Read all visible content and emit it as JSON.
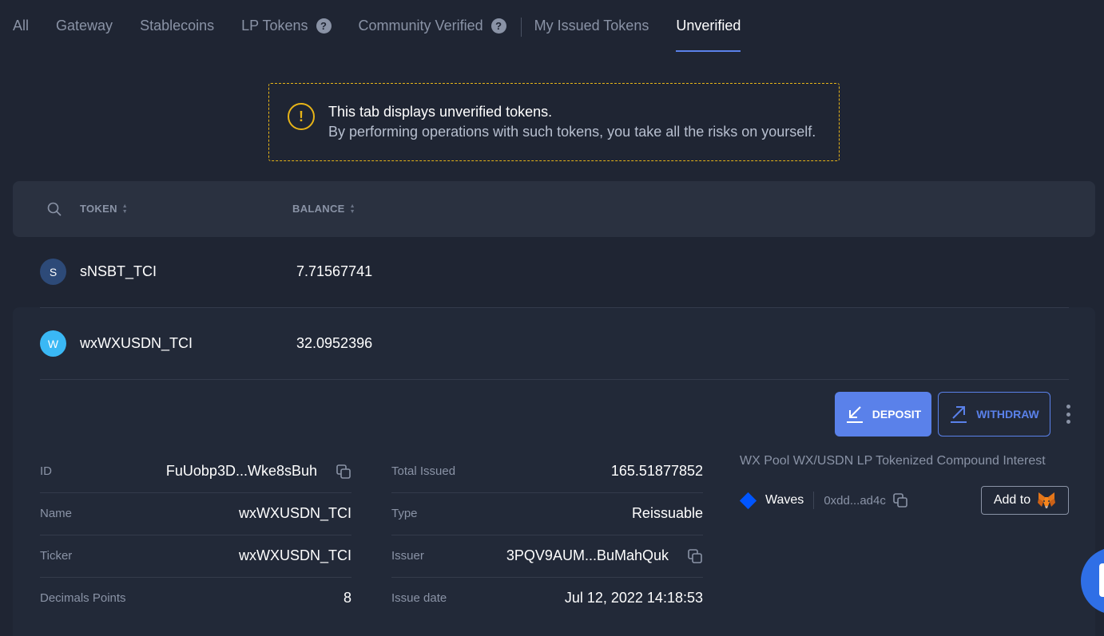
{
  "tabs": [
    {
      "label": "All",
      "active": false
    },
    {
      "label": "Gateway",
      "active": false
    },
    {
      "label": "Stablecoins",
      "active": false
    },
    {
      "label": "LP Tokens",
      "active": false,
      "help": "?"
    },
    {
      "label": "Community Verified",
      "active": false,
      "help": "?"
    },
    {
      "label": "My Issued Tokens",
      "active": false
    },
    {
      "label": "Unverified",
      "active": true
    }
  ],
  "warning": {
    "icon": "exclamation-circle-icon",
    "line1": "This tab displays unverified tokens.",
    "line2": "By performing operations with such tokens, you take all the risks on yourself.",
    "border_color": "#e7b418"
  },
  "table": {
    "search_icon": "search-icon",
    "columns": {
      "token": "TOKEN",
      "balance": "BALANCE"
    },
    "rows": [
      {
        "avatar": "S",
        "avatar_color": "#2d4a78",
        "name": "sNSBT_TCI",
        "balance": "7.71567741"
      },
      {
        "avatar": "W",
        "avatar_color": "#3ab8f5",
        "name": "wxWXUSDN_TCI",
        "balance": "32.0952396"
      }
    ]
  },
  "actions": {
    "deposit": "DEPOSIT",
    "withdraw": "WITHDRAW",
    "accent": "#5a81ea"
  },
  "details": {
    "left": [
      {
        "label": "ID",
        "value": "FuUobp3D...Wke8sBuh",
        "copy": true
      },
      {
        "label": "Name",
        "value": "wxWXUSDN_TCI"
      },
      {
        "label": "Ticker",
        "value": "wxWXUSDN_TCI"
      },
      {
        "label": "Decimals Points",
        "value": "8"
      }
    ],
    "right": [
      {
        "label": "Total Issued",
        "value": "165.51877852"
      },
      {
        "label": "Type",
        "value": "Reissuable"
      },
      {
        "label": "Issuer",
        "value": "3PQV9AUM...BuMahQuk",
        "copy": true
      },
      {
        "label": "Issue date",
        "value": "Jul 12, 2022 14:18:53"
      }
    ]
  },
  "info": {
    "description": "WX Pool WX/USDN LP Tokenized Compound Interest",
    "network": "Waves",
    "address": "0xdd...ad4c",
    "add_to": "Add to"
  }
}
